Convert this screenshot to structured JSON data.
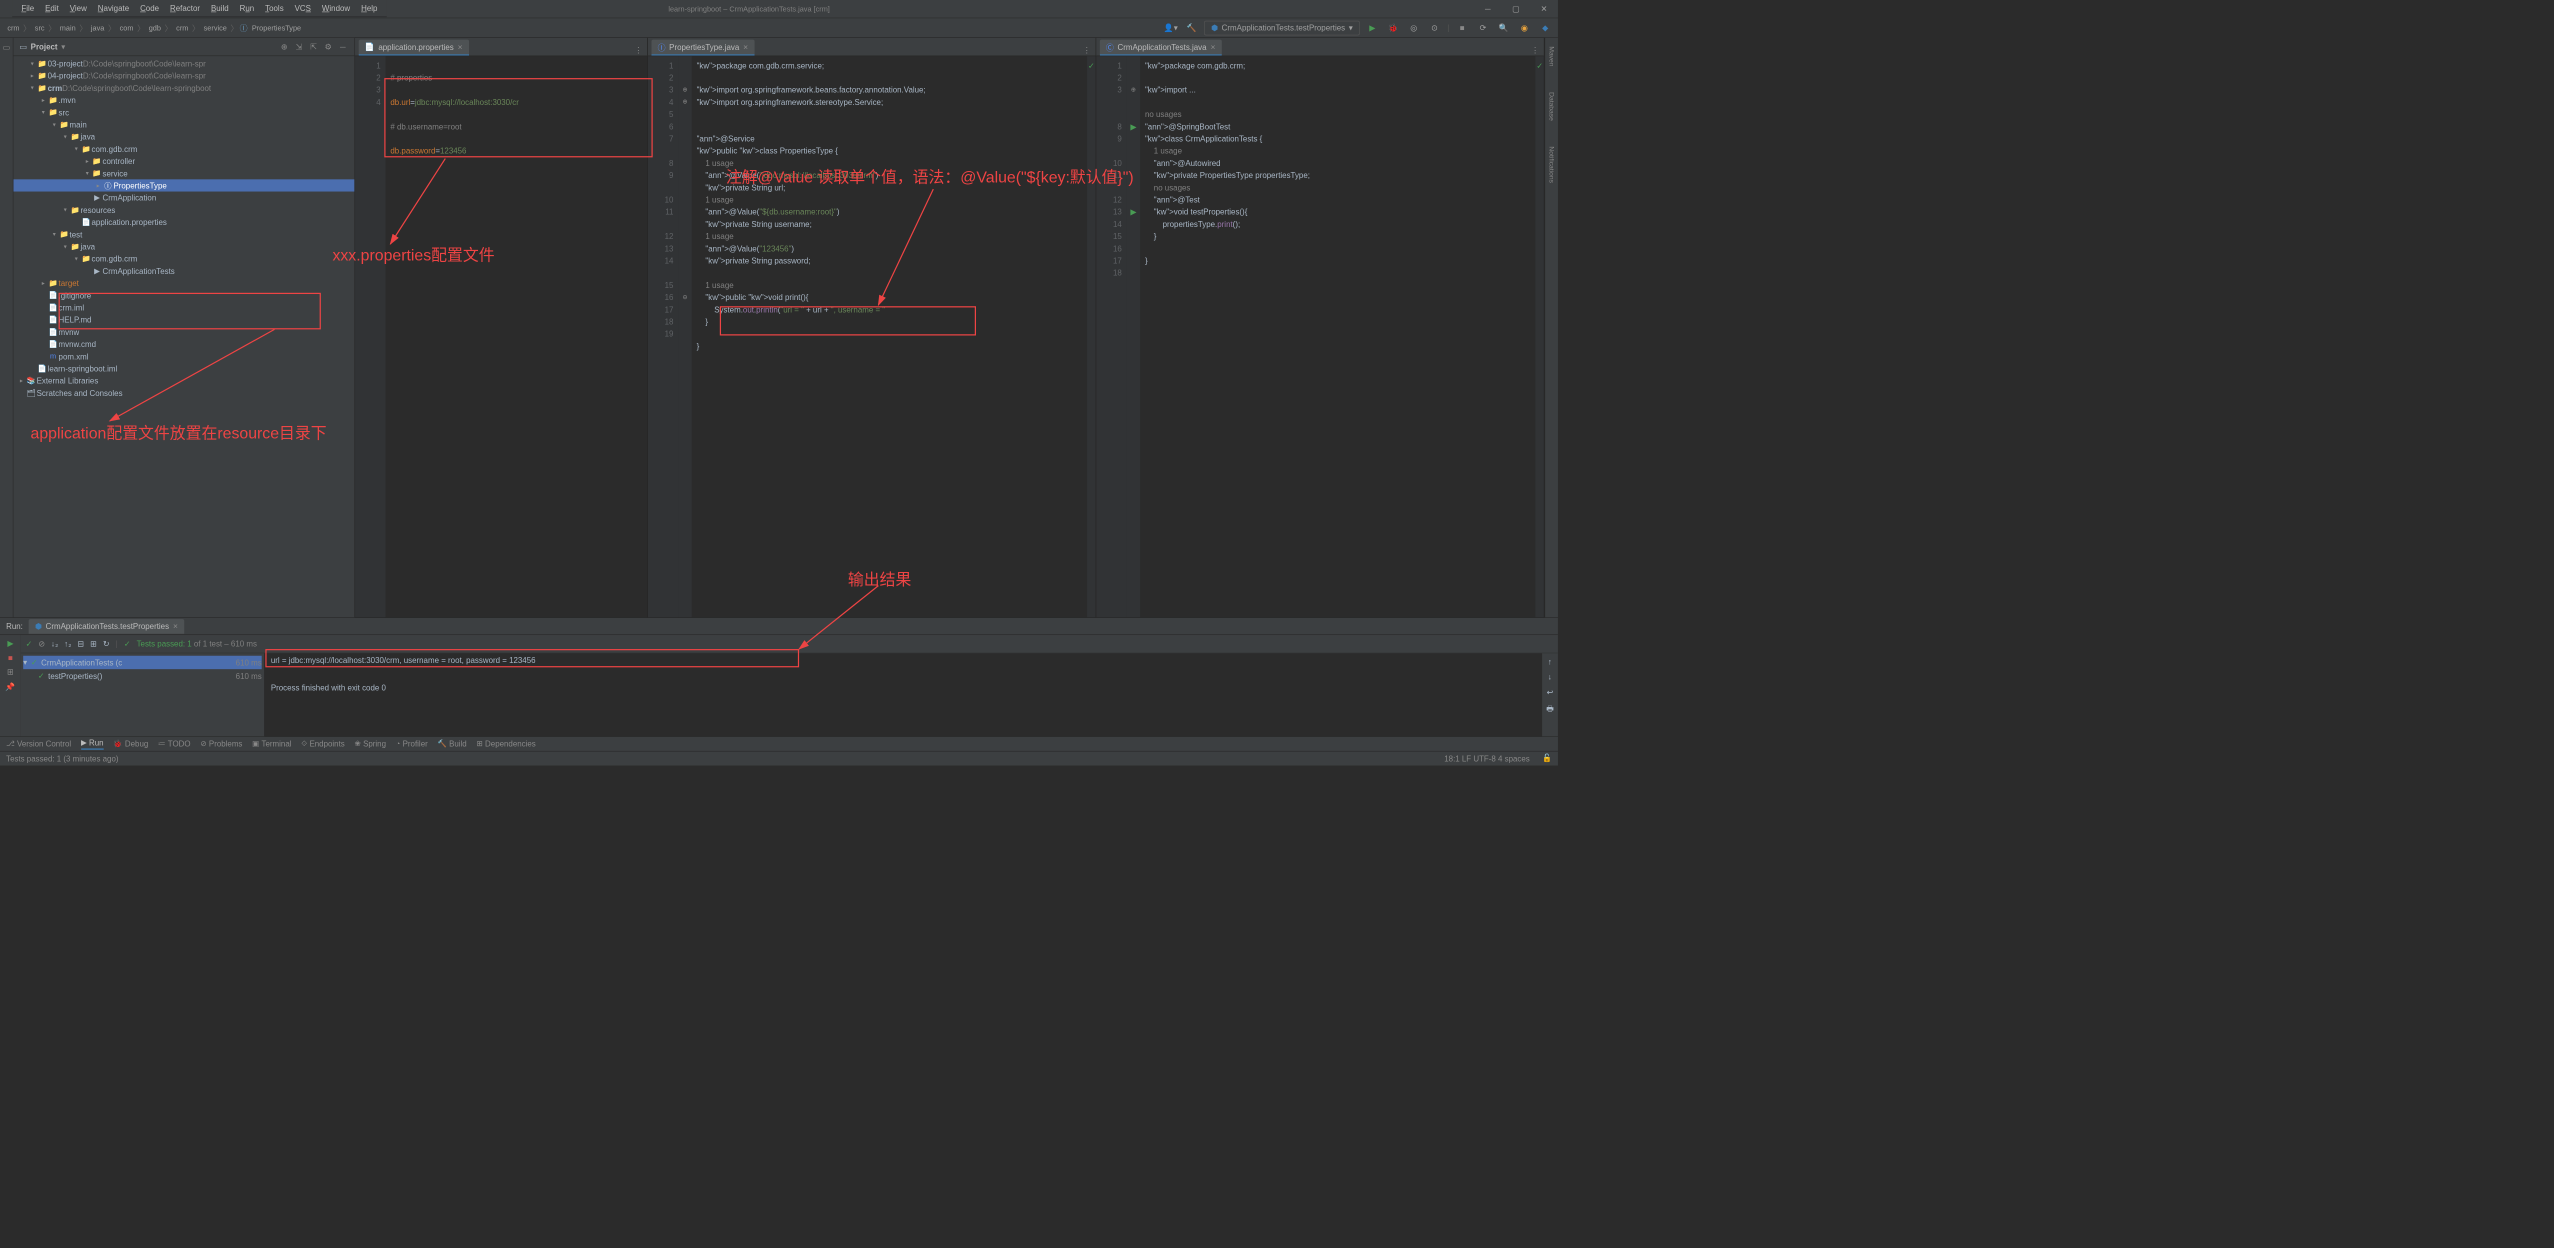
{
  "title": "learn-springboot – CrmApplicationTests.java [crm]",
  "menu": [
    "File",
    "Edit",
    "View",
    "Navigate",
    "Code",
    "Refactor",
    "Build",
    "Run",
    "Tools",
    "VCS",
    "Window",
    "Help"
  ],
  "breadcrumbs": [
    "crm",
    "src",
    "main",
    "java",
    "com",
    "gdb",
    "crm",
    "service",
    "PropertiesType"
  ],
  "run_config": "CrmApplicationTests.testProperties",
  "project_panel_title": "Project",
  "tree": [
    {
      "d": 1,
      "a": "▾",
      "i": "📁",
      "t": "03-project",
      "dim": "D:\\Code\\springboot\\Code\\learn-spr"
    },
    {
      "d": 1,
      "a": "▸",
      "i": "📁",
      "t": "04-project",
      "dim": "D:\\Code\\springboot\\Code\\learn-spr"
    },
    {
      "d": 1,
      "a": "▾",
      "i": "📁",
      "t": "crm",
      "dim": "D:\\Code\\springboot\\Code\\learn-springboot",
      "b": 1
    },
    {
      "d": 2,
      "a": "▸",
      "i": "📁",
      "t": ".mvn"
    },
    {
      "d": 2,
      "a": "▾",
      "i": "📁",
      "t": "src"
    },
    {
      "d": 3,
      "a": "▾",
      "i": "📁",
      "t": "main"
    },
    {
      "d": 4,
      "a": "▾",
      "i": "📁",
      "t": "java"
    },
    {
      "d": 5,
      "a": "▾",
      "i": "📁",
      "t": "com.gdb.crm"
    },
    {
      "d": 6,
      "a": "▸",
      "i": "📁",
      "t": "controller"
    },
    {
      "d": 6,
      "a": "▾",
      "i": "📁",
      "t": "service"
    },
    {
      "d": 7,
      "a": "▸",
      "i": "Ⓘ",
      "t": "PropertiesType",
      "sel": 1
    },
    {
      "d": 6,
      "a": "",
      "i": "▶",
      "t": "CrmApplication"
    },
    {
      "d": 4,
      "a": "▾",
      "i": "📁",
      "t": "resources"
    },
    {
      "d": 5,
      "a": "",
      "i": "📄",
      "t": "application.properties"
    },
    {
      "d": 3,
      "a": "▾",
      "i": "📁",
      "t": "test"
    },
    {
      "d": 4,
      "a": "▾",
      "i": "📁",
      "t": "java"
    },
    {
      "d": 5,
      "a": "▾",
      "i": "📁",
      "t": "com.gdb.crm"
    },
    {
      "d": 6,
      "a": "",
      "i": "▶",
      "t": "CrmApplicationTests"
    },
    {
      "d": 2,
      "a": "▸",
      "i": "📁",
      "t": "target",
      "c": "orange"
    },
    {
      "d": 2,
      "a": "",
      "i": "📄",
      "t": ".gitignore"
    },
    {
      "d": 2,
      "a": "",
      "i": "📄",
      "t": "crm.iml"
    },
    {
      "d": 2,
      "a": "",
      "i": "📄",
      "t": "HELP.md"
    },
    {
      "d": 2,
      "a": "",
      "i": "📄",
      "t": "mvnw"
    },
    {
      "d": 2,
      "a": "",
      "i": "📄",
      "t": "mvnw.cmd"
    },
    {
      "d": 2,
      "a": "",
      "i": "m",
      "t": "pom.xml",
      "ic": "blue"
    },
    {
      "d": 1,
      "a": "",
      "i": "📄",
      "t": "learn-springboot.iml"
    },
    {
      "d": 0,
      "a": "▸",
      "i": "📚",
      "t": "External Libraries"
    },
    {
      "d": 0,
      "a": "",
      "i": "🗂",
      "t": "Scratches and Consoles"
    }
  ],
  "ed1": {
    "tab": "application.properties",
    "lines": [
      {
        "n": 1,
        "c": "# properties",
        "cls": "com"
      },
      {
        "n": 2,
        "p1": "db.url",
        "eq": "=",
        "v": "jdbc:mysql://localhost:3030/cr"
      },
      {
        "n": 3,
        "c": "# db.username=root",
        "cls": "com"
      },
      {
        "n": 4,
        "p1": "db.password",
        "eq": "=",
        "v": "123456"
      }
    ]
  },
  "ed2": {
    "tab": "PropertiesType.java",
    "lines": [
      "package com.gdb.crm.service;",
      "",
      "import org.springframework.beans.factory.annotation.Value;",
      "import org.springframework.stereotype.Service;",
      "",
      "",
      "@Service",
      "public class PropertiesType {",
      "    1 usage",
      "    @Value(\"jdbc:mysql://localhost:3030/crm\")",
      "    private String url;",
      "    1 usage",
      "    @Value(\"${db.username:root}\")",
      "    private String username;",
      "    1 usage",
      "    @Value(\"123456\")",
      "    private String password;",
      "",
      "    1 usage",
      "    public void print(){",
      "        System.out.println(\"url = \" + url + \", username = \"",
      "    }",
      "",
      "}"
    ],
    "nums": [
      1,
      2,
      3,
      4,
      5,
      6,
      7,
      "",
      8,
      9,
      "",
      10,
      11,
      "",
      12,
      13,
      14,
      "",
      15,
      16,
      17,
      18,
      19
    ]
  },
  "ed3": {
    "tab": "CrmApplicationTests.java",
    "lines": [
      "package com.gdb.crm;",
      "",
      "import ...",
      "",
      "no usages",
      "@SpringBootTest",
      "class CrmApplicationTests {",
      "    1 usage",
      "    @Autowired",
      "    private PropertiesType propertiesType;",
      "    no usages",
      "    @Test",
      "    void testProperties(){",
      "        propertiesType.print();",
      "    }",
      "",
      "}",
      ""
    ],
    "nums": [
      1,
      2,
      3,
      "",
      "",
      8,
      9,
      "",
      10,
      11,
      "",
      12,
      13,
      14,
      15,
      16,
      17,
      18
    ]
  },
  "run": {
    "label": "Run:",
    "config": "CrmApplicationTests.testProperties",
    "pass": "Tests passed: 1",
    "pass2": " of 1 test – 610 ms",
    "test_root": "CrmApplicationTests (c",
    "root_ms": "610 ms",
    "test_child": "testProperties()",
    "child_ms": "610 ms",
    "out1": "url = jdbc:mysql://localhost:3030/crm, username = root, password = 123456",
    "out2": "Process finished with exit code 0"
  },
  "bottom_tabs": [
    "Version Control",
    "Run",
    "Debug",
    "TODO",
    "Problems",
    "Terminal",
    "Endpoints",
    "Spring",
    "Profiler",
    "Build",
    "Dependencies"
  ],
  "status": {
    "left": "Tests passed: 1 (3 minutes ago)",
    "right": "18:1  LF  UTF-8  4 spaces"
  },
  "annotations": {
    "a1": "xxx.properties配置文件",
    "a2": "application配置文件放置在resource目录下",
    "a3": "注解@Value 读取单个值，语法：@Value(\"${key:默认值}\")",
    "a4": "输出结果"
  },
  "right_strip": [
    "Maven",
    "Database",
    "Notifications"
  ]
}
